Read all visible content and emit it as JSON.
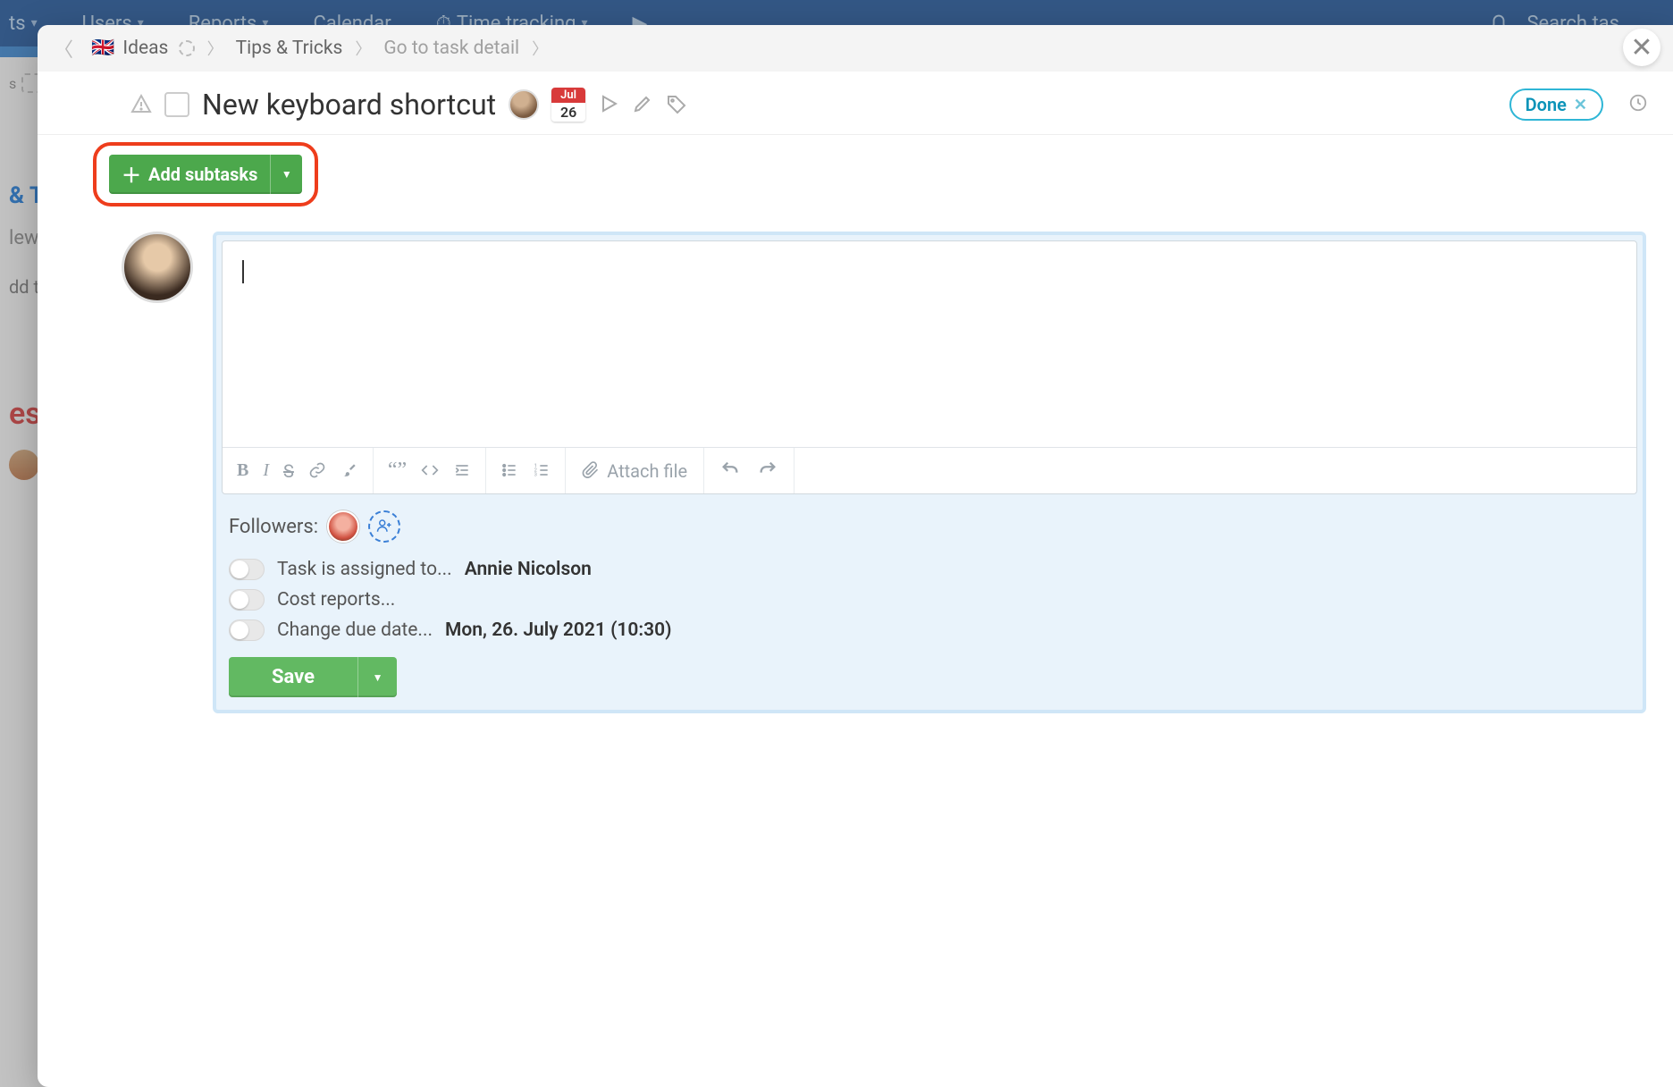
{
  "topnav": {
    "items": [
      "ts",
      "Users",
      "Reports",
      "Calendar",
      "Time tracking"
    ],
    "search_placeholder": "Search tas"
  },
  "bg": {
    "side1": "& T",
    "side2": "lew",
    "side3": "dd t",
    "side4": "es"
  },
  "breadcrumb": {
    "items": [
      "Ideas",
      "Tips & Tricks",
      "Go to task detail"
    ]
  },
  "task": {
    "title": "New keyboard shortcut",
    "cal_month": "Jul",
    "cal_day": "26",
    "done_label": "Done"
  },
  "subtask_button": "Add subtasks",
  "editor": {
    "toolbar": {
      "attach": "Attach file"
    }
  },
  "followers_label": "Followers:",
  "toggles": {
    "assign_label": "Task is assigned to...",
    "assign_value": "Annie Nicolson",
    "cost_label": "Cost reports...",
    "due_label": "Change due date...",
    "due_value": "Mon, 26. July 2021 (10:30)"
  },
  "save_label": "Save"
}
